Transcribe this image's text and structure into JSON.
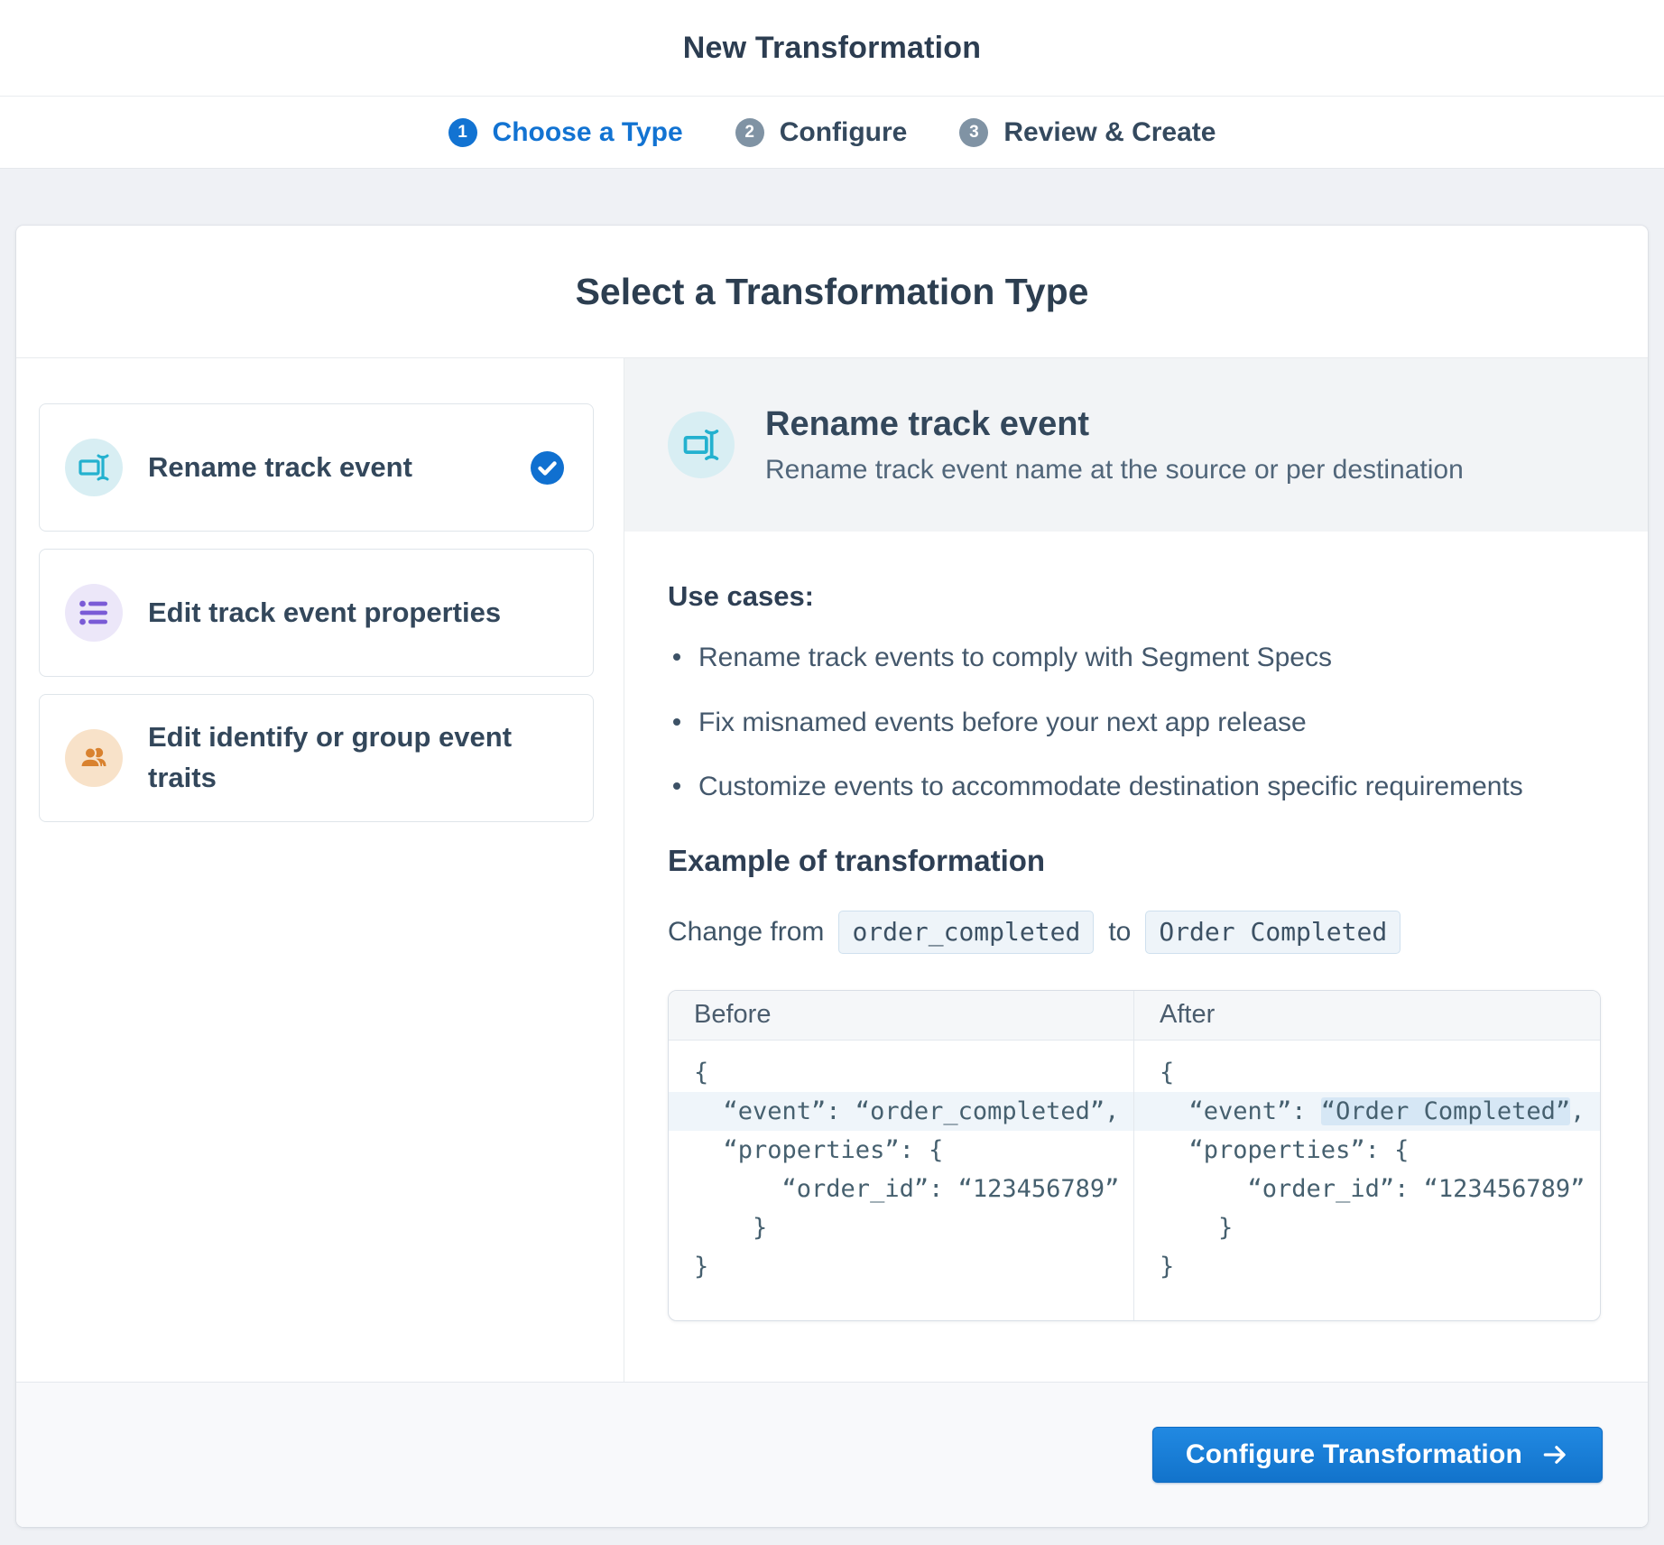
{
  "header": {
    "title": "New Transformation"
  },
  "stepper": {
    "steps": [
      {
        "number": "1",
        "label": "Choose a Type",
        "active": true
      },
      {
        "number": "2",
        "label": "Configure",
        "active": false
      },
      {
        "number": "3",
        "label": "Review & Create",
        "active": false
      }
    ]
  },
  "panel": {
    "title": "Select a Transformation Type"
  },
  "options": [
    {
      "label": "Rename track event",
      "icon": "rename-icon",
      "selected": true
    },
    {
      "label": "Edit track event properties",
      "icon": "list-icon",
      "selected": false
    },
    {
      "label": "Edit identify or group event traits",
      "icon": "users-icon",
      "selected": false
    }
  ],
  "detail": {
    "title": "Rename track event",
    "subtitle": "Rename track event name at the source or per destination",
    "use_cases_heading": "Use cases:",
    "use_cases": [
      "Rename track events to comply with Segment Specs",
      "Fix misnamed events before your next app release",
      "Customize events to accommodate destination specific requirements"
    ],
    "example_heading": "Example of transformation",
    "change": {
      "prefix": "Change from",
      "from_code": "order_completed",
      "connector": "to",
      "to_code": "Order Completed"
    },
    "table": {
      "before_label": "Before",
      "after_label": "After",
      "before": {
        "l1": "{",
        "l2": "  “event”: “order_completed”,",
        "l3": "  “properties”: {",
        "l4": "      “order_id”: “123456789”",
        "l5": "    }",
        "l6": "}"
      },
      "after": {
        "l1": "{",
        "l2_pre": "  “event”: ",
        "l2_mark": "“Order Completed”",
        "l2_post": ",",
        "l3": "  “properties”: {",
        "l4": "      “order_id”: “123456789”",
        "l5": "    }",
        "l6": "}"
      }
    }
  },
  "footer": {
    "button_label": "Configure Transformation",
    "button_icon": "arrow-right-icon"
  },
  "colors": {
    "accent_blue": "#1273d2",
    "step_inactive_gray": "#8093a4",
    "cyan_icon": "#23b1cf",
    "purple_icon": "#7a5bd6",
    "orange_icon": "#d9822f",
    "row_highlight": "#eff5fa",
    "mark_highlight": "#d6e7f5",
    "hero_band": "#f2f4f6"
  }
}
